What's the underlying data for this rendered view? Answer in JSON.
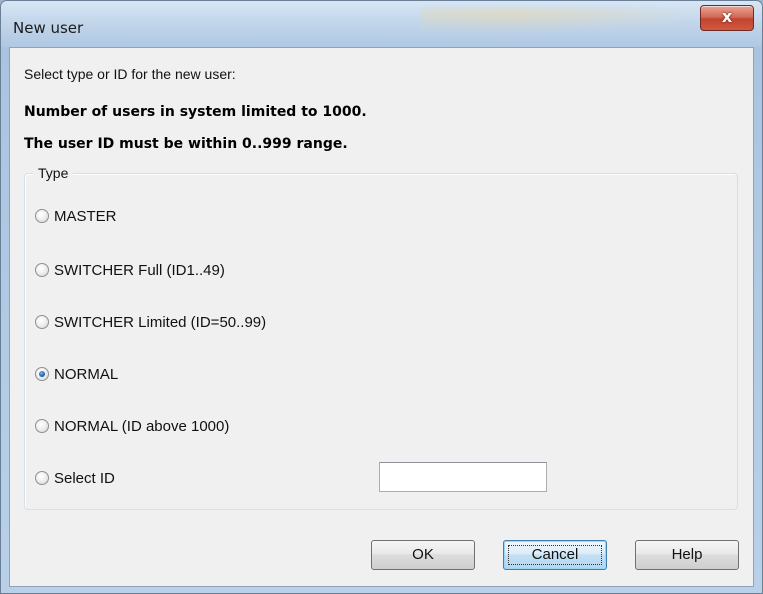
{
  "window": {
    "title": "New user",
    "close_label": "x"
  },
  "dialog": {
    "instruction": "Select type or ID for the new user:",
    "limit_text": "Number of users in system limited to 1000.",
    "range_text": "The user ID must be within 0..999 range."
  },
  "type_group": {
    "legend": "Type",
    "options": [
      {
        "label": "MASTER",
        "checked": false
      },
      {
        "label": "SWITCHER Full (ID1..49)",
        "checked": false
      },
      {
        "label": "SWITCHER Limited (ID=50..99)",
        "checked": false
      },
      {
        "label": "NORMAL",
        "checked": true
      },
      {
        "label": "NORMAL (ID above 1000)",
        "checked": false
      },
      {
        "label": "Select ID",
        "checked": false
      }
    ],
    "select_id_value": ""
  },
  "buttons": {
    "ok": "OK",
    "cancel": "Cancel",
    "help": "Help"
  },
  "colors": {
    "close_button": "#c1432e",
    "dialog_background": "#f0f0f0",
    "focused_button_border": "#3c7fb1",
    "radio_selected": "#2a66b0"
  }
}
